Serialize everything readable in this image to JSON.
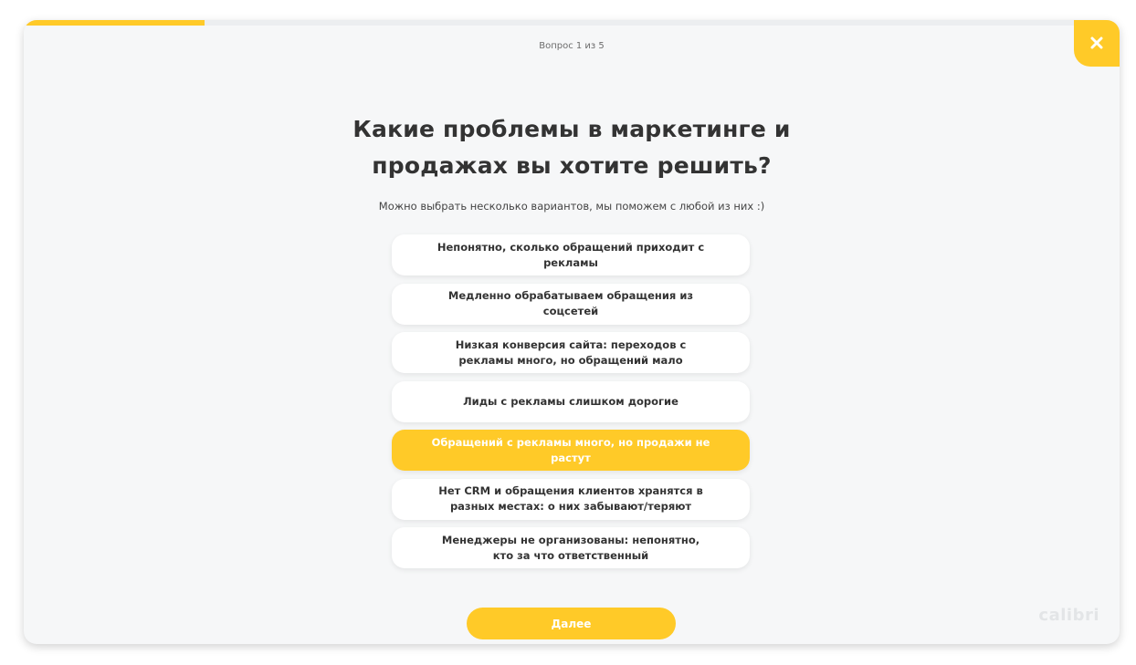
{
  "progress": {
    "label": "Вопрос 1 из 5",
    "fraction": 0.165
  },
  "question": {
    "title_line1": "Какие проблемы в маркетинге и",
    "title_line2": "продажах вы хотите решить?",
    "subtitle": "Можно выбрать несколько вариантов, мы поможем с любой из них :)"
  },
  "options": [
    {
      "label": "Непонятно, сколько обращений приходит с рекламы",
      "selected": false
    },
    {
      "label": "Медленно обрабатываем обращения из соцсетей",
      "selected": false
    },
    {
      "label": "Низкая конверсия сайта: переходов с рекламы много, но обращений мало",
      "selected": false
    },
    {
      "label": "Лиды с рекламы слишком дорогие",
      "selected": false
    },
    {
      "label": "Обращений с рекламы много, но продажи не растут",
      "selected": true
    },
    {
      "label": "Нет CRM и обращения клиентов хранятся в разных местах: о них забывают/теряют",
      "selected": false
    },
    {
      "label": "Менеджеры не организованы: непонятно, кто за что ответственный",
      "selected": false
    }
  ],
  "next_button": {
    "label": "Далее"
  },
  "logo": {
    "text": "calibri"
  },
  "colors": {
    "accent": "#ffca28",
    "modal_bg": "#f6f7f8",
    "text": "#333333"
  },
  "icons": {
    "close": "close-icon"
  }
}
